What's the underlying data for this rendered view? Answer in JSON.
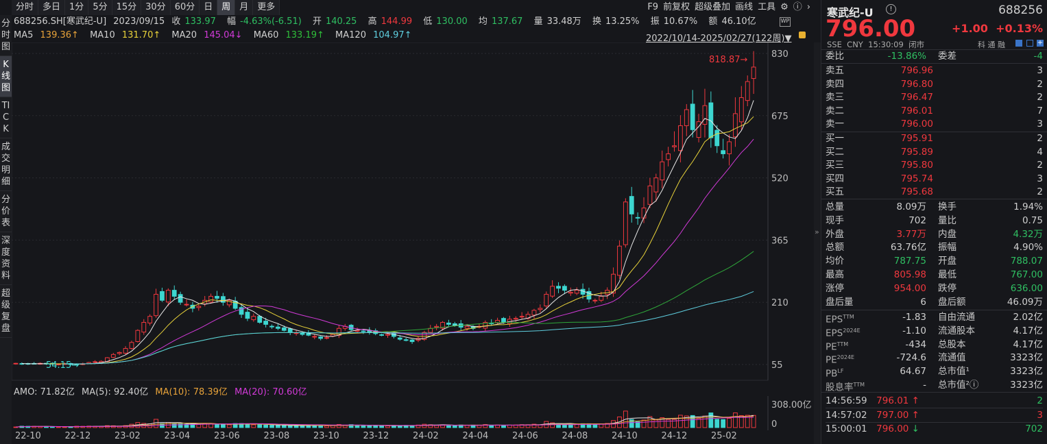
{
  "toolbar": {
    "tabs": [
      "分时",
      "多日",
      "1分",
      "5分",
      "15分",
      "30分",
      "60分",
      "日",
      "周",
      "月",
      "更多"
    ],
    "active": "周",
    "right": [
      "F9",
      "前复权",
      "超级叠加",
      "画线",
      "工具"
    ]
  },
  "leftnav": [
    "分时图",
    "K线图",
    "TICK",
    "成交明细",
    "分价表",
    "深度资料",
    "超级复盘"
  ],
  "info": {
    "code": "688256.SH[寒武纪-U]",
    "date": "2023/09/15",
    "close_label": "收",
    "close": "133.97",
    "chg_label": "幅",
    "chg": "-4.63%(-6.51)",
    "open_label": "开",
    "open": "140.25",
    "high_label": "高",
    "high": "144.99",
    "low_label": "低",
    "low": "130.00",
    "avg_label": "均",
    "avg": "137.67",
    "vol_label": "量",
    "vol": "33.48万",
    "turn_label": "换",
    "turn": "13.25%",
    "amp_label": "振",
    "amp": "10.67%",
    "amt_label": "额",
    "amt": "46.10亿"
  },
  "ma": {
    "ma5": "MA5",
    "ma5v": "139.36↑",
    "ma10": "MA10",
    "ma10v": "131.70↑",
    "ma20": "MA20",
    "ma20v": "145.04↓",
    "ma60": "MA60",
    "ma60v": "133.19↑",
    "ma120": "MA120",
    "ma120v": "104.97↑"
  },
  "range": "2022/10/14-2025/02/27(122周)▼",
  "colors": {
    "up": "#f0383e",
    "down": "#3dd6d0",
    "ma5": "#e8e8e8",
    "ma10": "#e8d23a",
    "ma20": "#d23ad8",
    "ma60": "#2fa83a",
    "ma120": "#5fcfe0"
  },
  "chart_data": {
    "type": "candlestick",
    "ylim": [
      55,
      830
    ],
    "yticks": [
      "830",
      "675",
      "520",
      "365",
      "210",
      "55"
    ],
    "xticks": [
      "22-10",
      "22-12",
      "23-02",
      "23-04",
      "23-06",
      "23-08",
      "23-10",
      "23-12",
      "24-02",
      "24-04",
      "24-06",
      "24-08",
      "24-10",
      "24-12",
      "25-02"
    ],
    "max_label": "818.87→",
    "min_label": "54.15→",
    "close": [
      58,
      57,
      56,
      57,
      58,
      57,
      56,
      56,
      57,
      55,
      56,
      57,
      60,
      62,
      63,
      72,
      80,
      85,
      95,
      110,
      140,
      160,
      175,
      230,
      215,
      240,
      225,
      210,
      205,
      195,
      200,
      215,
      225,
      220,
      210,
      215,
      195,
      180,
      170,
      175,
      160,
      155,
      150,
      145,
      140,
      135,
      134,
      130,
      128,
      125,
      120,
      122,
      130,
      145,
      150,
      142,
      140,
      138,
      135,
      132,
      128,
      130,
      125,
      118,
      115,
      112,
      120,
      135,
      145,
      150,
      160,
      155,
      152,
      148,
      150,
      145,
      150,
      160,
      158,
      165,
      160,
      168,
      170,
      175,
      180,
      190,
      195,
      230,
      250,
      245,
      240,
      235,
      240,
      230,
      218,
      215,
      225,
      240,
      280,
      350,
      460,
      430,
      420,
      445,
      500,
      520,
      560,
      580,
      600,
      650,
      690,
      640,
      660,
      700,
      620,
      600,
      580,
      610,
      680,
      720,
      760,
      796
    ],
    "volume_axis": [
      "308.00亿",
      "0"
    ]
  },
  "vol": {
    "amo": "AMO: 71.82亿",
    "ma5": "MA(5): 92.40亿",
    "ma10": "MA(10): 78.39亿",
    "ma20": "MA(20): 70.60亿"
  },
  "quote": {
    "name": "寒武纪-U",
    "code": "688256",
    "price": "796.00",
    "change": "+1.00",
    "pct": "+0.13%",
    "sub": "SSE  CNY  15:30:09  闭市",
    "tags": "科 通 融",
    "weibi_label": "委比",
    "weibi": "-13.86%",
    "weicha_label": "委差",
    "weicha": "-4",
    "sells": [
      {
        "l": "卖五",
        "p": "796.96",
        "q": "3"
      },
      {
        "l": "卖四",
        "p": "796.80",
        "q": "2"
      },
      {
        "l": "卖三",
        "p": "796.47",
        "q": "2"
      },
      {
        "l": "卖二",
        "p": "796.01",
        "q": "7"
      },
      {
        "l": "卖一",
        "p": "796.00",
        "q": "3"
      }
    ],
    "buys": [
      {
        "l": "买一",
        "p": "795.91",
        "q": "2"
      },
      {
        "l": "买二",
        "p": "795.89",
        "q": "4"
      },
      {
        "l": "买三",
        "p": "795.80",
        "q": "2"
      },
      {
        "l": "买四",
        "p": "795.74",
        "q": "3"
      },
      {
        "l": "买五",
        "p": "795.68",
        "q": "2"
      }
    ],
    "stats": [
      {
        "l": "总量",
        "v": "8.09万",
        "l2": "换手",
        "v2": "1.94%"
      },
      {
        "l": "现手",
        "v": "702",
        "l2": "量比",
        "v2": "0.75"
      },
      {
        "l": "外盘",
        "v": "3.77万",
        "l2": "内盘",
        "v2": "4.32万"
      },
      {
        "l": "总额",
        "v": "63.76亿",
        "l2": "振幅",
        "v2": "4.90%"
      },
      {
        "l": "均价",
        "v": "787.75",
        "l2": "开盘",
        "v2": "788.07"
      },
      {
        "l": "最高",
        "v": "805.98",
        "l2": "最低",
        "v2": "767.00"
      },
      {
        "l": "涨停",
        "v": "954.00",
        "l2": "跌停",
        "v2": "636.00"
      },
      {
        "l": "盘后量",
        "v": "6",
        "l2": "盘后额",
        "v2": "46.09万"
      }
    ],
    "fund": [
      {
        "l": "EPS",
        "s": "TTM",
        "v": "-1.83",
        "l2": "自由流通",
        "v2": "2.02亿"
      },
      {
        "l": "EPS",
        "s": "2024E",
        "v": "-1.10",
        "l2": "流通股本",
        "v2": "4.17亿"
      },
      {
        "l": "PE",
        "s": "TTM",
        "v": "-434",
        "l2": "总股本",
        "v2": "4.17亿"
      },
      {
        "l": "PE",
        "s": "2024E",
        "v": "-724.6",
        "l2": "流通值",
        "v2": "3323亿"
      },
      {
        "l": "PB",
        "s": "LF",
        "v": "64.67",
        "l2": "总市值¹",
        "v2": "3323亿"
      },
      {
        "l": "股息率",
        "s": "TTM",
        "v": "-",
        "l2": "总市值²ⓘ",
        "v2": "3323亿"
      }
    ],
    "ticks": [
      {
        "t": "14:56:59",
        "p": "796.01",
        "d": "up",
        "q": "2"
      },
      {
        "t": "14:57:02",
        "p": "797.00",
        "d": "up",
        "q": "3"
      },
      {
        "t": "15:00:01",
        "p": "796.00",
        "d": "down",
        "q": "702"
      }
    ]
  }
}
